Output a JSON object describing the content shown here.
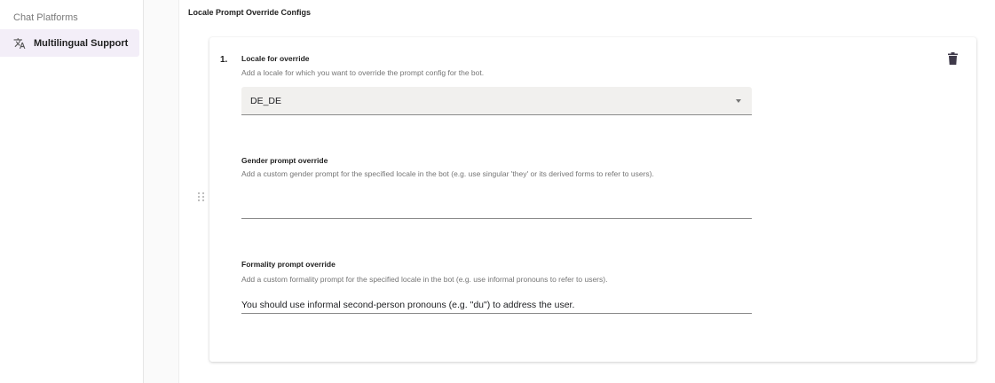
{
  "sidebar": {
    "items": [
      {
        "label": "Chat Platforms"
      },
      {
        "label": "Multilingual Support",
        "icon": "translate-icon",
        "active": true
      }
    ]
  },
  "main": {
    "section_title": "Locale Prompt Override Configs",
    "override": {
      "number": "1.",
      "locale": {
        "label": "Locale for override",
        "description": "Add a locale for which you want to override the prompt config for the bot.",
        "selected": "DE_DE"
      },
      "gender": {
        "label": "Gender prompt override",
        "description": "Add a custom gender prompt for the specified locale in the bot (e.g. use singular 'they' or its derived forms to refer to users).",
        "value": ""
      },
      "formality": {
        "label": "Formality prompt override",
        "description": "Add a custom formality prompt for the specified locale in the bot (e.g. use informal pronouns to refer to users).",
        "value": "You should use informal second-person pronouns (e.g. \"du\") to address the user."
      }
    }
  },
  "colors": {
    "accent_bg": "#f3eef8",
    "select_bg": "#f1f0ee",
    "delete_icon": "#3f3a4a"
  }
}
